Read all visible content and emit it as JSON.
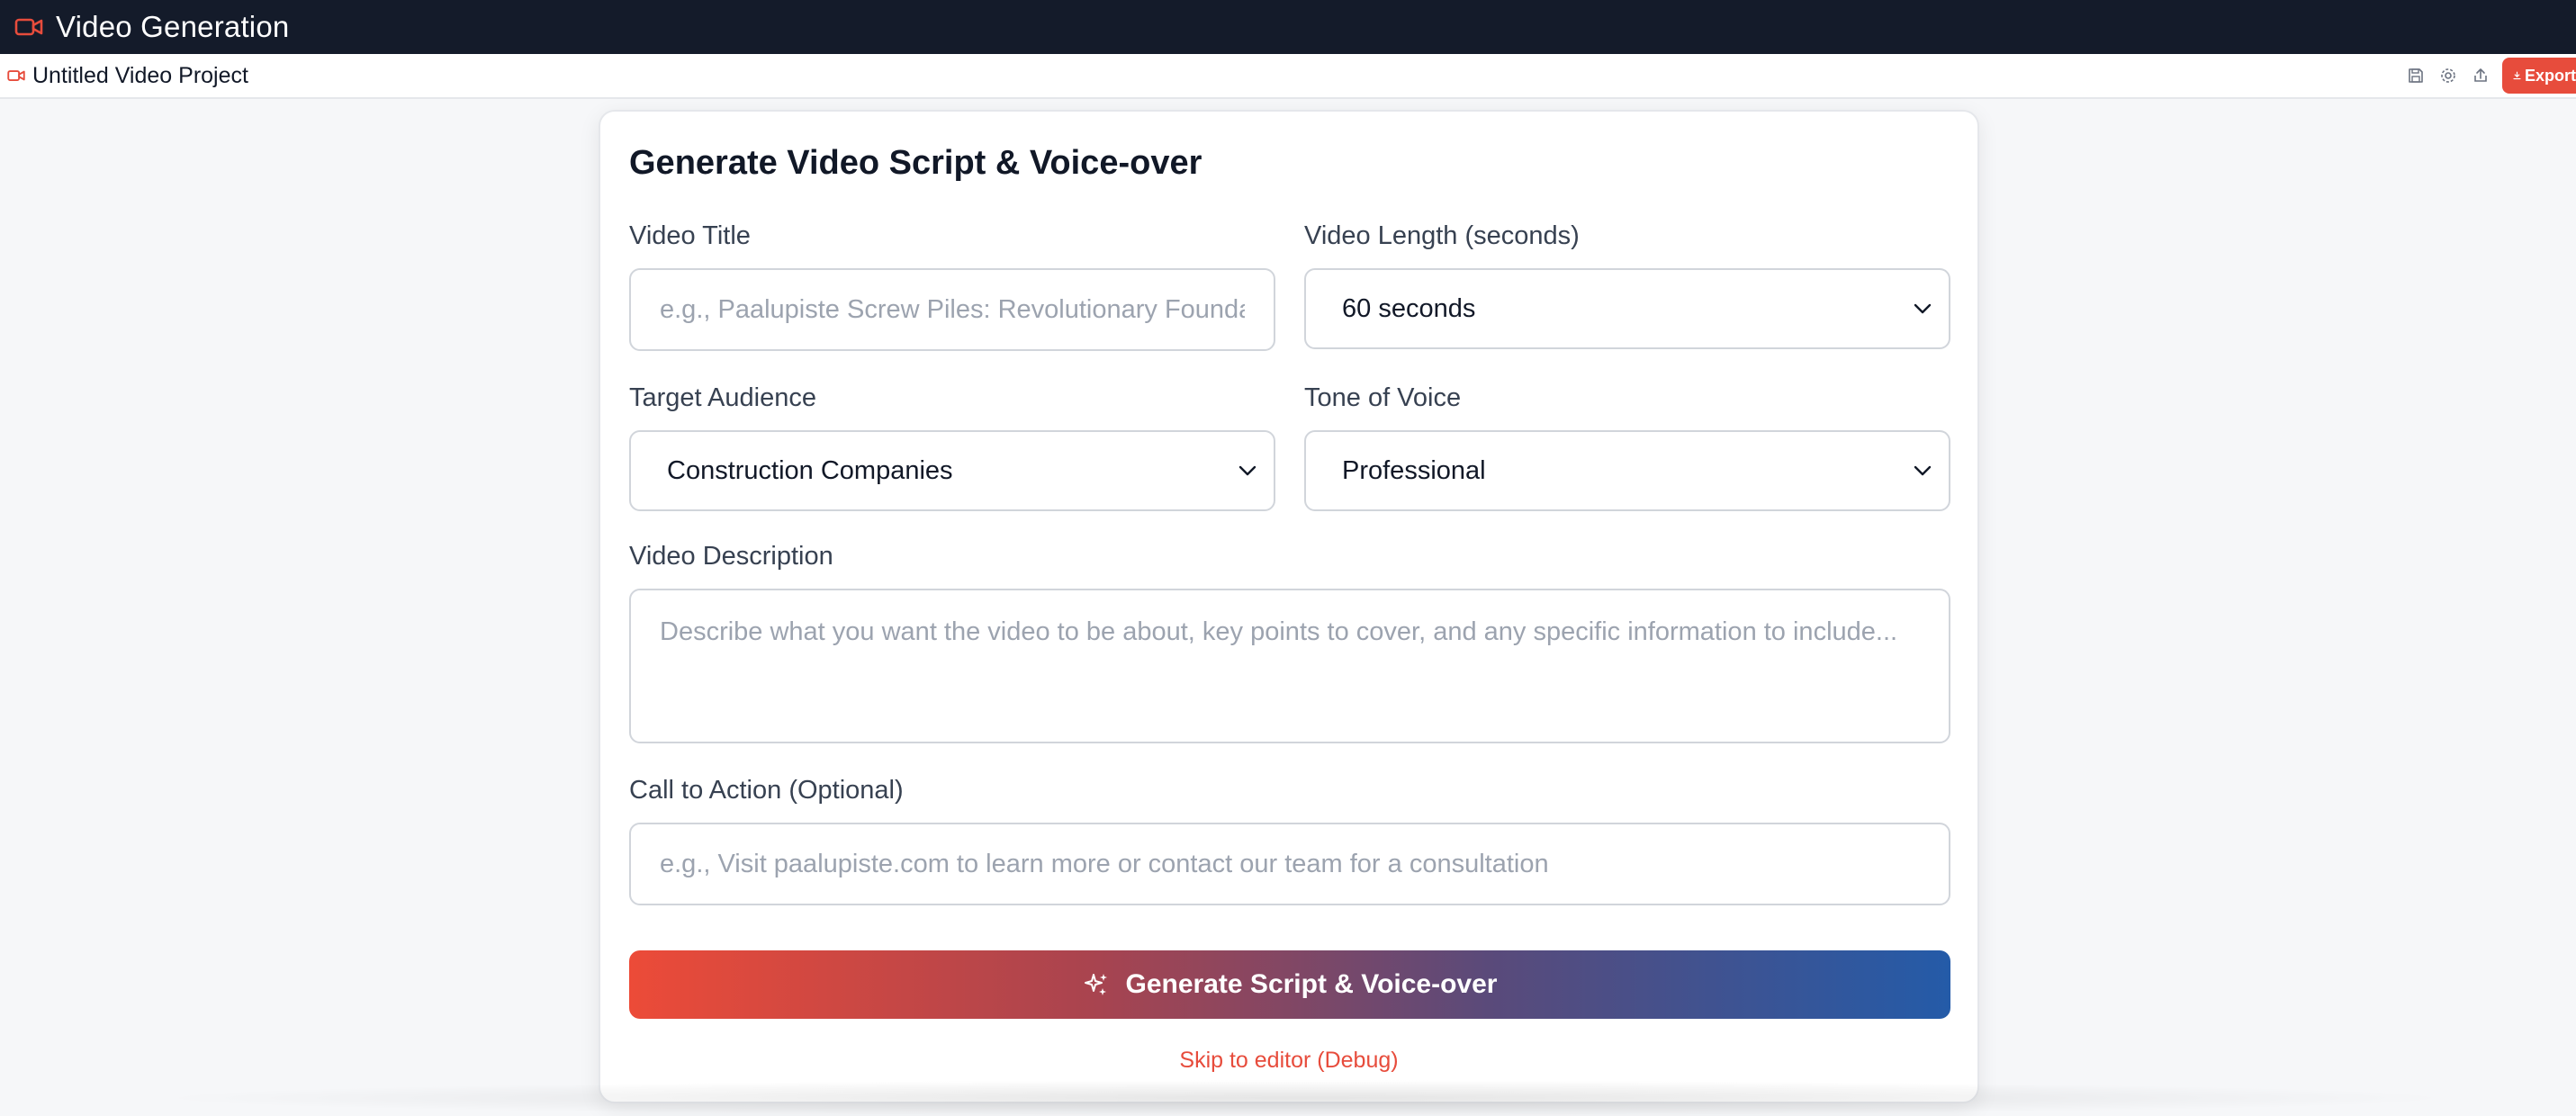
{
  "app": {
    "title": "Video Generation",
    "project_name": "Untitled Video Project",
    "accent_color": "#e74c3c",
    "header_bg": "#141b2a"
  },
  "toolbar": {
    "icons": [
      "save-icon",
      "gear-icon",
      "share-icon"
    ],
    "export_label": "Export"
  },
  "form": {
    "heading": "Generate Video Script & Voice-over",
    "video_title": {
      "label": "Video Title",
      "value": "",
      "placeholder": "e.g., Paalupiste Screw Piles: Revolutionary Foundation"
    },
    "video_length": {
      "label": "Video Length (seconds)",
      "selected": "60 seconds"
    },
    "target_audience": {
      "label": "Target Audience",
      "selected": "Construction Companies"
    },
    "tone": {
      "label": "Tone of Voice",
      "selected": "Professional"
    },
    "description": {
      "label": "Video Description",
      "value": "",
      "placeholder": "Describe what you want the video to be about, key points to cover, and any specific information to include..."
    },
    "cta": {
      "label": "Call to Action (Optional)",
      "value": "",
      "placeholder": "e.g., Visit paalupiste.com to learn more or contact our team for a consultation"
    },
    "generate_label": "Generate Script & Voice-over",
    "skip_label": "Skip to editor (Debug)"
  }
}
